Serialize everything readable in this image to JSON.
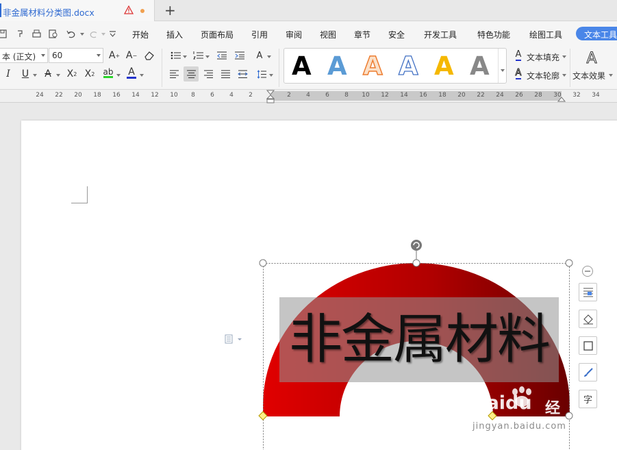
{
  "tab": {
    "title": "非金属材料分类图.docx"
  },
  "menu": [
    "开始",
    "插入",
    "页面布局",
    "引用",
    "审阅",
    "视图",
    "章节",
    "安全",
    "开发工具",
    "特色功能",
    "绘图工具"
  ],
  "menu_active": "文本工具",
  "ribbon": {
    "font_name": "本 (正文)",
    "font_size": "60",
    "text_fill": "文本填充",
    "text_outline": "文本轮廓",
    "text_effect": "文本效果",
    "style_letter": "A"
  },
  "ruler": {
    "left_ticks": [
      "24",
      "22",
      "20",
      "18",
      "16",
      "14",
      "12",
      "10",
      "8",
      "6",
      "4",
      "2"
    ],
    "right_ticks": [
      "2",
      "4",
      "6",
      "8",
      "10",
      "12",
      "14",
      "16",
      "18",
      "20",
      "22",
      "24",
      "26",
      "28",
      "30",
      "32",
      "34"
    ]
  },
  "wordart": {
    "text": "非金属材料"
  },
  "watermark": {
    "brand": "Baidu",
    "cn": "经验",
    "url": "jingyan.baidu.com"
  },
  "colors": {
    "accent": "#4a86e8",
    "wordart_red": "#c00000",
    "tab_title": "#2f6ad1"
  }
}
